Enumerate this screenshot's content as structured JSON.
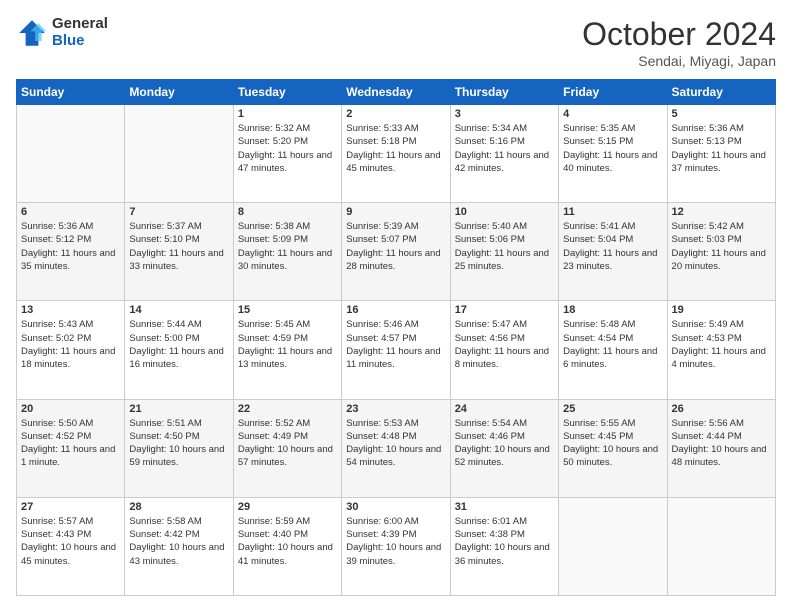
{
  "logo": {
    "general": "General",
    "blue": "Blue"
  },
  "header": {
    "month": "October 2024",
    "location": "Sendai, Miyagi, Japan"
  },
  "weekdays": [
    "Sunday",
    "Monday",
    "Tuesday",
    "Wednesday",
    "Thursday",
    "Friday",
    "Saturday"
  ],
  "weeks": [
    [
      {
        "day": "",
        "info": ""
      },
      {
        "day": "",
        "info": ""
      },
      {
        "day": "1",
        "info": "Sunrise: 5:32 AM\nSunset: 5:20 PM\nDaylight: 11 hours and 47 minutes."
      },
      {
        "day": "2",
        "info": "Sunrise: 5:33 AM\nSunset: 5:18 PM\nDaylight: 11 hours and 45 minutes."
      },
      {
        "day": "3",
        "info": "Sunrise: 5:34 AM\nSunset: 5:16 PM\nDaylight: 11 hours and 42 minutes."
      },
      {
        "day": "4",
        "info": "Sunrise: 5:35 AM\nSunset: 5:15 PM\nDaylight: 11 hours and 40 minutes."
      },
      {
        "day": "5",
        "info": "Sunrise: 5:36 AM\nSunset: 5:13 PM\nDaylight: 11 hours and 37 minutes."
      }
    ],
    [
      {
        "day": "6",
        "info": "Sunrise: 5:36 AM\nSunset: 5:12 PM\nDaylight: 11 hours and 35 minutes."
      },
      {
        "day": "7",
        "info": "Sunrise: 5:37 AM\nSunset: 5:10 PM\nDaylight: 11 hours and 33 minutes."
      },
      {
        "day": "8",
        "info": "Sunrise: 5:38 AM\nSunset: 5:09 PM\nDaylight: 11 hours and 30 minutes."
      },
      {
        "day": "9",
        "info": "Sunrise: 5:39 AM\nSunset: 5:07 PM\nDaylight: 11 hours and 28 minutes."
      },
      {
        "day": "10",
        "info": "Sunrise: 5:40 AM\nSunset: 5:06 PM\nDaylight: 11 hours and 25 minutes."
      },
      {
        "day": "11",
        "info": "Sunrise: 5:41 AM\nSunset: 5:04 PM\nDaylight: 11 hours and 23 minutes."
      },
      {
        "day": "12",
        "info": "Sunrise: 5:42 AM\nSunset: 5:03 PM\nDaylight: 11 hours and 20 minutes."
      }
    ],
    [
      {
        "day": "13",
        "info": "Sunrise: 5:43 AM\nSunset: 5:02 PM\nDaylight: 11 hours and 18 minutes."
      },
      {
        "day": "14",
        "info": "Sunrise: 5:44 AM\nSunset: 5:00 PM\nDaylight: 11 hours and 16 minutes."
      },
      {
        "day": "15",
        "info": "Sunrise: 5:45 AM\nSunset: 4:59 PM\nDaylight: 11 hours and 13 minutes."
      },
      {
        "day": "16",
        "info": "Sunrise: 5:46 AM\nSunset: 4:57 PM\nDaylight: 11 hours and 11 minutes."
      },
      {
        "day": "17",
        "info": "Sunrise: 5:47 AM\nSunset: 4:56 PM\nDaylight: 11 hours and 8 minutes."
      },
      {
        "day": "18",
        "info": "Sunrise: 5:48 AM\nSunset: 4:54 PM\nDaylight: 11 hours and 6 minutes."
      },
      {
        "day": "19",
        "info": "Sunrise: 5:49 AM\nSunset: 4:53 PM\nDaylight: 11 hours and 4 minutes."
      }
    ],
    [
      {
        "day": "20",
        "info": "Sunrise: 5:50 AM\nSunset: 4:52 PM\nDaylight: 11 hours and 1 minute."
      },
      {
        "day": "21",
        "info": "Sunrise: 5:51 AM\nSunset: 4:50 PM\nDaylight: 10 hours and 59 minutes."
      },
      {
        "day": "22",
        "info": "Sunrise: 5:52 AM\nSunset: 4:49 PM\nDaylight: 10 hours and 57 minutes."
      },
      {
        "day": "23",
        "info": "Sunrise: 5:53 AM\nSunset: 4:48 PM\nDaylight: 10 hours and 54 minutes."
      },
      {
        "day": "24",
        "info": "Sunrise: 5:54 AM\nSunset: 4:46 PM\nDaylight: 10 hours and 52 minutes."
      },
      {
        "day": "25",
        "info": "Sunrise: 5:55 AM\nSunset: 4:45 PM\nDaylight: 10 hours and 50 minutes."
      },
      {
        "day": "26",
        "info": "Sunrise: 5:56 AM\nSunset: 4:44 PM\nDaylight: 10 hours and 48 minutes."
      }
    ],
    [
      {
        "day": "27",
        "info": "Sunrise: 5:57 AM\nSunset: 4:43 PM\nDaylight: 10 hours and 45 minutes."
      },
      {
        "day": "28",
        "info": "Sunrise: 5:58 AM\nSunset: 4:42 PM\nDaylight: 10 hours and 43 minutes."
      },
      {
        "day": "29",
        "info": "Sunrise: 5:59 AM\nSunset: 4:40 PM\nDaylight: 10 hours and 41 minutes."
      },
      {
        "day": "30",
        "info": "Sunrise: 6:00 AM\nSunset: 4:39 PM\nDaylight: 10 hours and 39 minutes."
      },
      {
        "day": "31",
        "info": "Sunrise: 6:01 AM\nSunset: 4:38 PM\nDaylight: 10 hours and 36 minutes."
      },
      {
        "day": "",
        "info": ""
      },
      {
        "day": "",
        "info": ""
      }
    ]
  ]
}
